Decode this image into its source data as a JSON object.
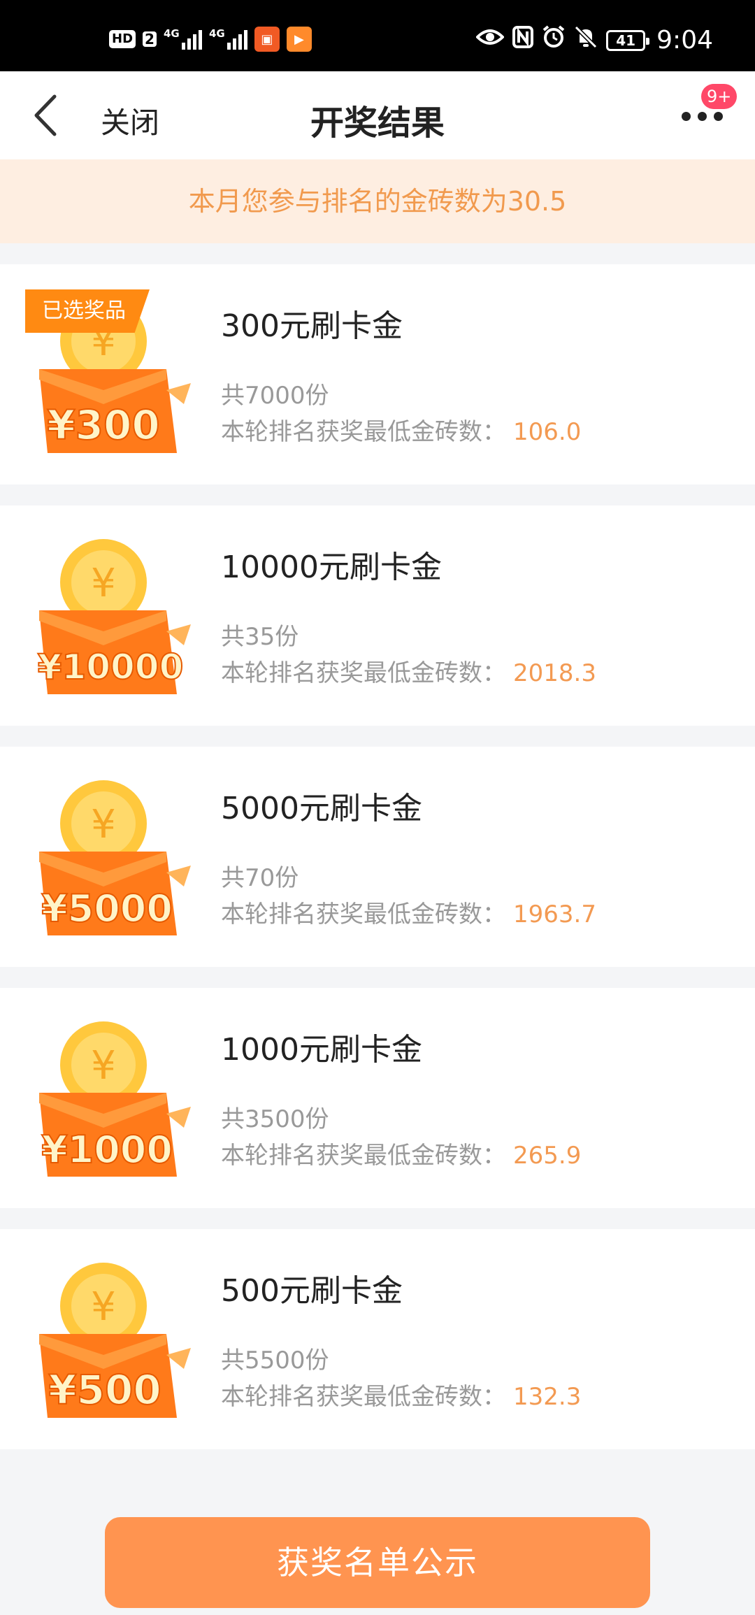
{
  "status_bar": {
    "hd": "HD",
    "sim": "2",
    "net1": "4G",
    "net2": "4G",
    "battery": "41",
    "time": "9:04",
    "icons": [
      "eye-icon",
      "nfc-icon",
      "alarm-icon",
      "mute-icon"
    ]
  },
  "nav": {
    "close_label": "关闭",
    "title": "开奖结果",
    "badge": "9+"
  },
  "notice": "本月您参与排名的金砖数为30.5",
  "prizes": [
    {
      "name": "300元刷卡金",
      "count": "共7000份",
      "min_label": "本轮排名获奖最低金砖数：",
      "min_value": "106.0",
      "amount": "¥300",
      "tag": "已选奖品"
    },
    {
      "name": "10000元刷卡金",
      "count": "共35份",
      "min_label": "本轮排名获奖最低金砖数：",
      "min_value": "2018.3",
      "amount": "¥10000"
    },
    {
      "name": "5000元刷卡金",
      "count": "共70份",
      "min_label": "本轮排名获奖最低金砖数：",
      "min_value": "1963.7",
      "amount": "¥5000"
    },
    {
      "name": "1000元刷卡金",
      "count": "共3500份",
      "min_label": "本轮排名获奖最低金砖数：",
      "min_value": "265.9",
      "amount": "¥1000"
    },
    {
      "name": "500元刷卡金",
      "count": "共5500份",
      "min_label": "本轮排名获奖最低金砖数：",
      "min_value": "132.3",
      "amount": "¥500"
    }
  ],
  "coin_symbol": "¥",
  "announce_button": "获奖名单公示",
  "colors": {
    "accent": "#ff9450",
    "notice_bg": "#feeee1",
    "notice_text": "#f19a4e",
    "value": "#f39a52",
    "tag": "#ff8a12",
    "badge": "#ff4868"
  }
}
